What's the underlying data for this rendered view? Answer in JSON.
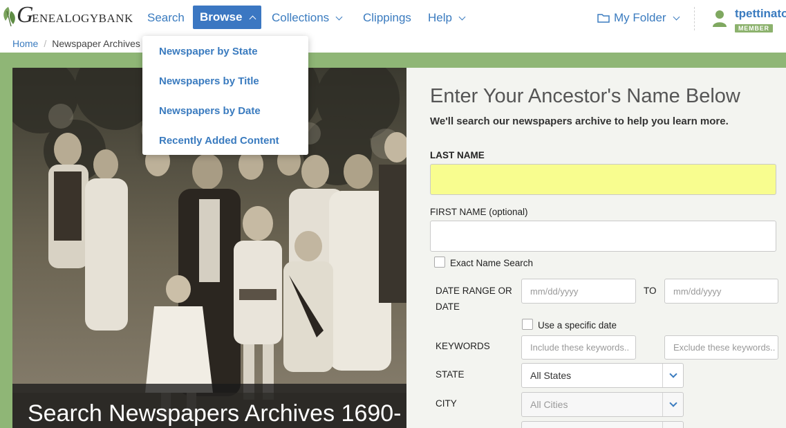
{
  "brand": {
    "logo_text": "ENEALOGYBANK",
    "logo_initial": "G"
  },
  "nav": {
    "search": "Search",
    "browse": "Browse",
    "collections": "Collections",
    "clippings": "Clippings",
    "help": "Help"
  },
  "folder": {
    "label": "My Folder"
  },
  "user": {
    "name": "tpettinato",
    "badge": "MEMBER"
  },
  "breadcrumb": {
    "home": "Home",
    "separator": "/",
    "current": "Newspaper Archives"
  },
  "browse_menu": {
    "items": [
      "Newspaper by State",
      "Newspapers by Title",
      "Newspapers by Date",
      "Recently Added Content"
    ]
  },
  "hero": {
    "caption": "Search Newspapers Archives 1690-"
  },
  "form": {
    "title": "Enter Your Ancestor's Name Below",
    "subtitle": "We'll search our newspapers archive to help you learn more.",
    "last_name_label": "LAST NAME",
    "last_name_value": "",
    "first_name_label": "FIRST NAME (optional)",
    "first_name_value": "",
    "exact_label": "Exact Name Search",
    "date_range_label_1": "DATE RANGE OR",
    "date_range_label_2": "DATE",
    "date_from_placeholder": "mm/dd/yyyy",
    "to_label": "TO",
    "date_to_placeholder": "mm/dd/yyyy",
    "specific_date_label": "Use a specific date",
    "keywords_label": "KEYWORDS",
    "include_placeholder": "Include these keywords..",
    "exclude_placeholder": "Exclude these keywords..",
    "state_label": "STATE",
    "state_value": "All States",
    "city_label": "CITY",
    "city_value": "All Cities"
  },
  "colors": {
    "link_blue": "#3a7bbf",
    "browse_active": "#3b77c2",
    "band_green": "#8fb676",
    "badge_green": "#8cb26d",
    "last_name_highlight": "#f8fd8f"
  },
  "icons": [
    "leaf-logo-icon",
    "chevron-down-icon",
    "chevron-up-icon",
    "folder-icon",
    "user-avatar-icon"
  ]
}
